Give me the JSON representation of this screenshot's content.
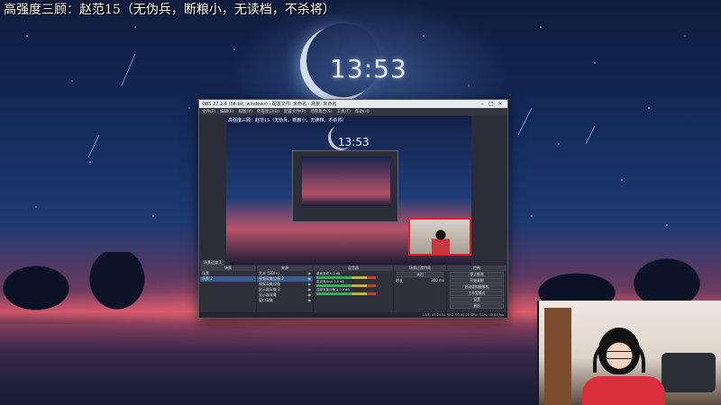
{
  "overlay": {
    "caption": "高强度三顾：赵范15（无伪兵，断粮小，无读档，不杀将）",
    "clock": "13:53"
  },
  "obs": {
    "title": "OBS 27.2.4 (64-bit, windows) - 配置文件: 未命名 - 场景: 未命名",
    "menu": [
      "文件(F)",
      "编辑(E)",
      "视图(V)",
      "停靠窗口(D)",
      "配置文件(P)",
      "场景集合(S)",
      "工具(T)",
      "帮助(H)"
    ],
    "preview": {
      "caption": "高强度三顾：赵范15（无伪兵，断粮小，无读档，不杀将）",
      "clock": "13:53"
    },
    "tab_label": "场景过渡 1",
    "docks": {
      "scenes": {
        "header": "场景",
        "items": [
          "场景",
          "场景 2"
        ]
      },
      "sources": {
        "header": "来源",
        "items": [
          "文本 (GDI+)",
          "视频采集设备 2",
          "视频采集设备",
          "显示器采集 2",
          "显示器采集",
          "窗口采集"
        ]
      },
      "mixer": {
        "header": "混音器",
        "channels": [
          {
            "label": "桌面音频",
            "level": "0.0 dB"
          },
          {
            "label": "麦克风/Aux",
            "level": "0.0 dB"
          },
          {
            "label": "视频采集设备 2",
            "level": "0.0 dB"
          }
        ]
      },
      "transitions": {
        "header": "场景过渡特效",
        "type_label": "淡出",
        "duration_label": "时长",
        "duration_value": "300 ms"
      },
      "controls": {
        "header": "控制",
        "buttons": [
          "停止推流",
          "开始录制",
          "启动虚拟摄像机",
          "工作室模式",
          "设置",
          "退出"
        ]
      }
    },
    "status": "LIVE: 00:24:51  REC: 00:00:00  CPU: 3.1%, 30.00 fps"
  }
}
